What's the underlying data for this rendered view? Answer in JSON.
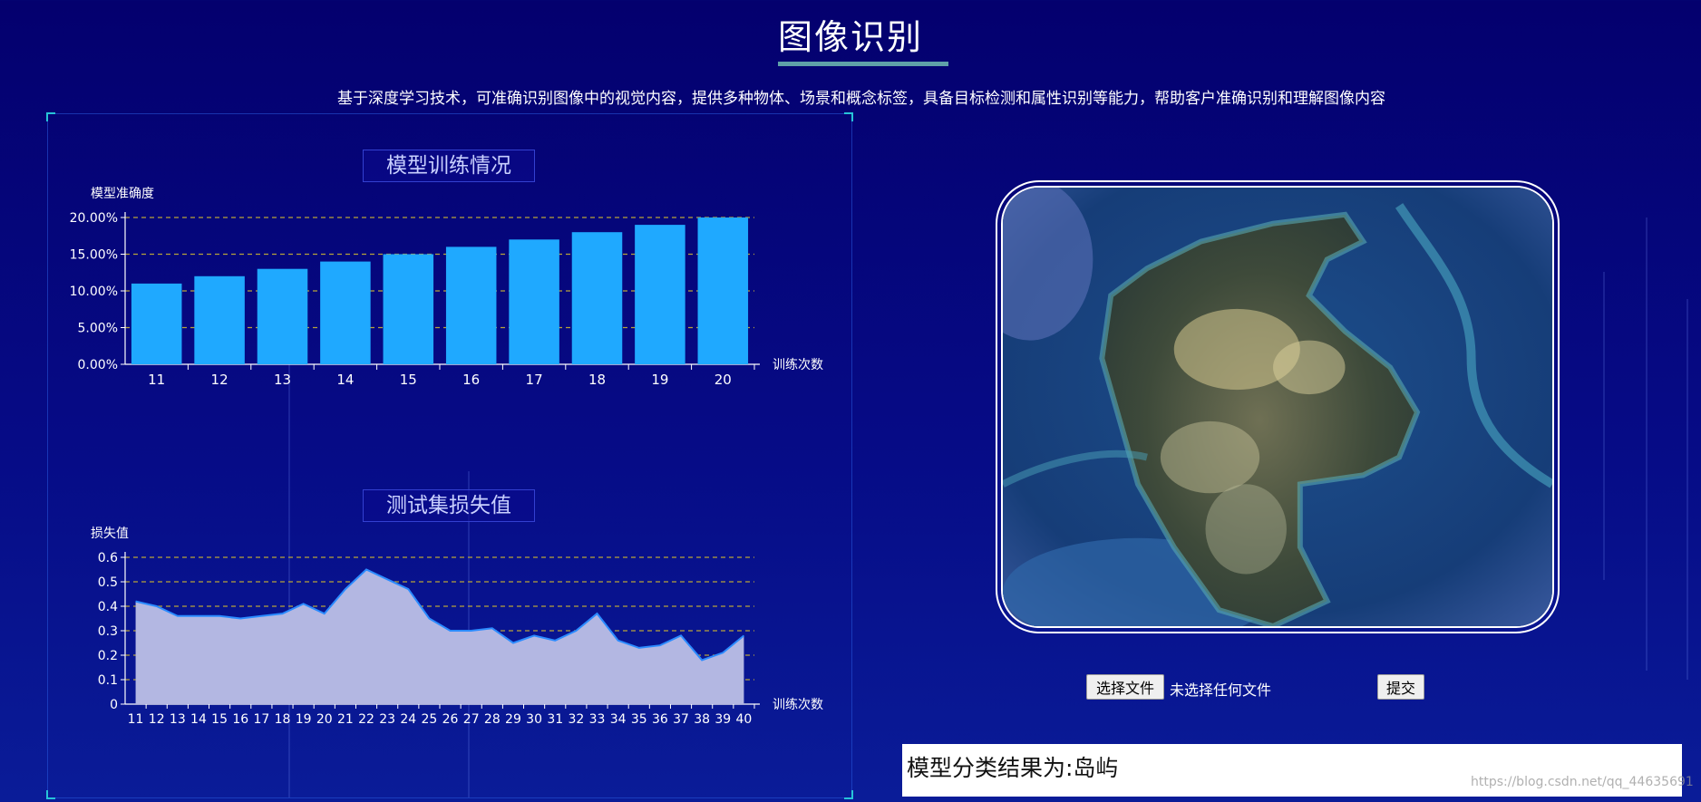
{
  "page": {
    "title": "图像识别",
    "subtitle": "基于深度学习技术，可准确识别图像中的视觉内容，提供多种物体、场景和概念标签，具备目标检测和属性识别等能力，帮助客户准确识别和理解图像内容"
  },
  "chart_data": [
    {
      "type": "bar",
      "title": "模型训练情况",
      "ylabel": "模型准确度",
      "xlabel": "训练次数",
      "categories": [
        "11",
        "12",
        "13",
        "14",
        "15",
        "16",
        "17",
        "18",
        "19",
        "20"
      ],
      "values": [
        11,
        12,
        13,
        14,
        15,
        16,
        17,
        18,
        19,
        20
      ],
      "value_format": "percent",
      "yticks": [
        "0.00%",
        "5.00%",
        "10.00%",
        "15.00%",
        "20.00%"
      ],
      "ylim": [
        0,
        20
      ],
      "grid": true,
      "bar_color": "#1fa9ff"
    },
    {
      "type": "area",
      "title": "测试集损失值",
      "ylabel": "损失值",
      "xlabel": "训练次数",
      "categories": [
        "11",
        "12",
        "13",
        "14",
        "15",
        "16",
        "17",
        "18",
        "19",
        "20",
        "21",
        "22",
        "23",
        "24",
        "25",
        "26",
        "27",
        "28",
        "29",
        "30",
        "31",
        "32",
        "33",
        "34",
        "35",
        "36",
        "37",
        "38",
        "39",
        "40"
      ],
      "values": [
        0.42,
        0.4,
        0.36,
        0.36,
        0.36,
        0.35,
        0.36,
        0.37,
        0.41,
        0.37,
        0.47,
        0.55,
        0.51,
        0.47,
        0.35,
        0.3,
        0.3,
        0.31,
        0.25,
        0.28,
        0.26,
        0.3,
        0.37,
        0.26,
        0.23,
        0.24,
        0.28,
        0.18,
        0.21,
        0.28
      ],
      "yticks": [
        "0",
        "0.1",
        "0.2",
        "0.3",
        "0.4",
        "0.5",
        "0.6"
      ],
      "ylim": [
        0,
        0.6
      ],
      "grid": true,
      "line_color": "#2b8bff",
      "fill_color": "#b3b7e2"
    }
  ],
  "upload": {
    "choose_file_label": "选择文件",
    "file_status": "未选择任何文件",
    "submit_label": "提交"
  },
  "result": {
    "text": "模型分类结果为:岛屿"
  },
  "watermark": "https://blog.csdn.net/qq_44635691"
}
